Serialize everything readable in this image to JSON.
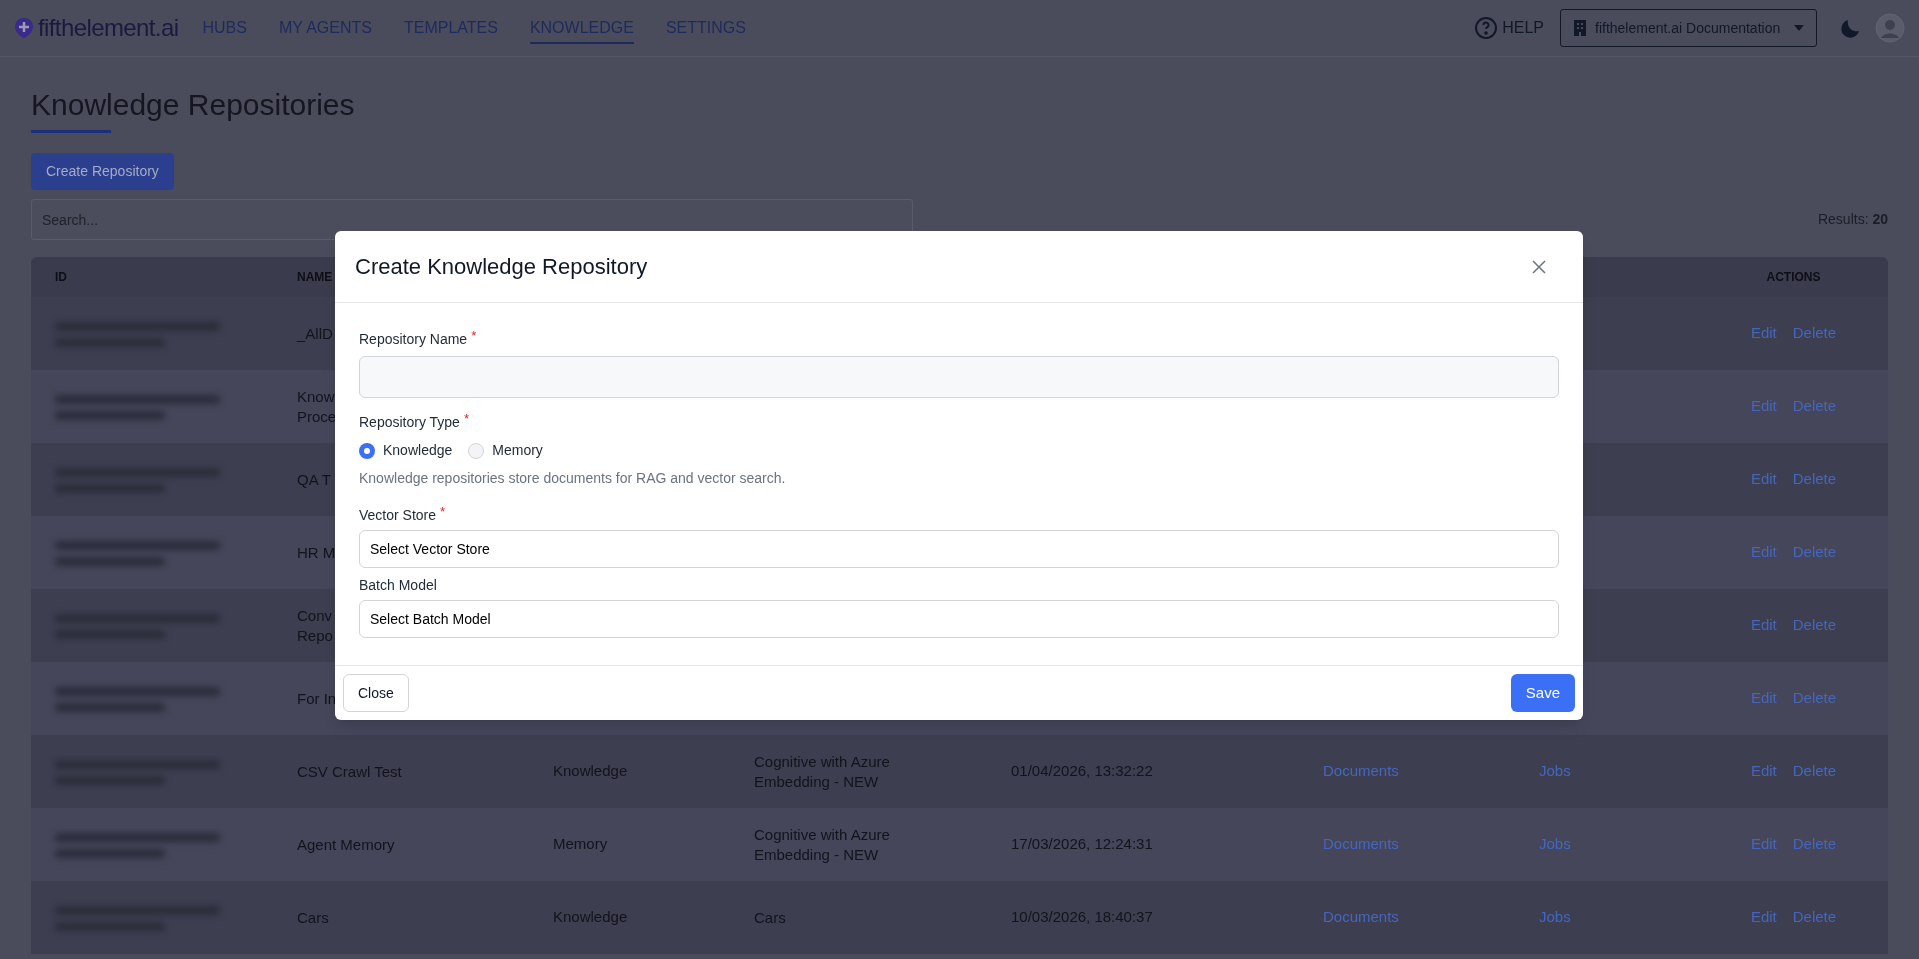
{
  "nav": {
    "logo": "fifthelement.ai",
    "items": [
      {
        "label": "HUBS",
        "selected": false
      },
      {
        "label": "MY AGENTS",
        "selected": false
      },
      {
        "label": "TEMPLATES",
        "selected": false
      },
      {
        "label": "KNOWLEDGE",
        "selected": true
      },
      {
        "label": "SETTINGS",
        "selected": false
      }
    ],
    "help": "HELP",
    "org": "fifthelement.ai Documentation"
  },
  "page": {
    "title": "Knowledge Repositories",
    "create_button": "Create Repository",
    "search": {
      "placeholder": "Search..."
    },
    "results": "Results: **20**"
  },
  "table": {
    "columns": [
      {
        "label": "ID"
      },
      {
        "label": "NAME"
      },
      {
        "label": "ACTIONS"
      }
    ],
    "rows": [
      {
        "name_lines": [
          "_AllD"
        ],
        "edit": "Edit",
        "delete": "Delete"
      },
      {
        "name_lines": [
          "Know",
          "Proce"
        ],
        "edit": "Edit",
        "delete": "Delete"
      },
      {
        "name_lines": [
          "QA T"
        ],
        "edit": "Edit",
        "delete": "Delete"
      },
      {
        "name_lines": [
          "HR M"
        ],
        "edit": "Edit",
        "delete": "Delete"
      },
      {
        "name_lines": [
          "Conv",
          "Repo"
        ],
        "edit": "Edit",
        "delete": "Delete"
      },
      {
        "name_lines": [
          "For In"
        ],
        "edit": "Edit",
        "delete": "Delete"
      },
      {
        "name_lines": [
          "CSV Crawl Test"
        ],
        "type": "Knowledge",
        "vector_store": "Cognitive with Azure Embedding - NEW",
        "created": "01/04/2026, 13:32:22",
        "documents": "Documents",
        "jobs": "Jobs",
        "edit": "Edit",
        "delete": "Delete"
      },
      {
        "name_lines": [
          "Agent Memory"
        ],
        "type": "Memory",
        "vector_store": "Cognitive with Azure Embedding - NEW",
        "created": "17/03/2026, 12:24:31",
        "documents": "Documents",
        "jobs": "Jobs",
        "edit": "Edit",
        "delete": "Delete"
      },
      {
        "name_lines": [
          "Cars"
        ],
        "type": "Knowledge",
        "vector_store": "Cars",
        "created": "10/03/2026, 18:40:37",
        "documents": "Documents",
        "jobs": "Jobs",
        "edit": "Edit",
        "delete": "Delete"
      }
    ]
  },
  "modal": {
    "title": "Create Knowledge Repository",
    "fields": [
      {
        "kind": "text",
        "label": "Repository Name",
        "required_mark": "*"
      },
      {
        "kind": "radio",
        "label": "Repository Type",
        "required_mark": "*",
        "options": [
          {
            "label": "Knowledge",
            "selected": true
          },
          {
            "label": "Memory",
            "selected": false
          }
        ],
        "help": "Knowledge repositories store documents for RAG and vector search."
      },
      {
        "kind": "select",
        "label": "Vector Store",
        "required_mark": "*",
        "value": "Select Vector Store"
      },
      {
        "kind": "select",
        "label": "Batch Model",
        "value": "Select Batch Model"
      }
    ],
    "close_button": "Close",
    "save_button": "Save"
  }
}
